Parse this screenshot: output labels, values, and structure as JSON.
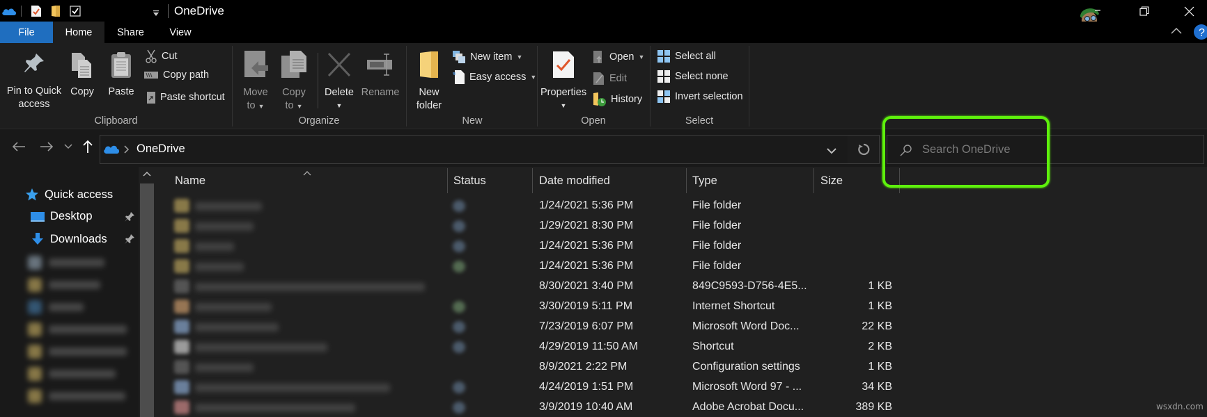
{
  "window": {
    "title": "OneDrive",
    "restore_label": "Restore",
    "close_label": "Close"
  },
  "quick_access_toolbar": {
    "icons": [
      "onedrive-icon",
      "properties-icon",
      "new-folder-icon",
      "checkbox-icon",
      "customize-dropdown-icon"
    ]
  },
  "ribbon_tabs": [
    {
      "label": "File",
      "active": false
    },
    {
      "label": "Home",
      "active": true
    },
    {
      "label": "Share",
      "active": false
    },
    {
      "label": "View",
      "active": false
    }
  ],
  "ribbon": {
    "clipboard": {
      "group_label": "Clipboard",
      "pin_line1": "Pin to Quick",
      "pin_line2": "access",
      "copy": "Copy",
      "paste": "Paste",
      "cut": "Cut",
      "copy_path": "Copy path",
      "paste_shortcut": "Paste shortcut"
    },
    "organize": {
      "group_label": "Organize",
      "move_line1": "Move",
      "move_line2": "to",
      "copy_line1": "Copy",
      "copy_line2": "to",
      "delete": "Delete",
      "rename": "Rename"
    },
    "new": {
      "group_label": "New",
      "new_folder_line1": "New",
      "new_folder_line2": "folder",
      "new_item": "New item",
      "easy_access": "Easy access"
    },
    "open": {
      "group_label": "Open",
      "properties": "Properties",
      "open": "Open",
      "edit": "Edit",
      "history": "History"
    },
    "select": {
      "group_label": "Select",
      "select_all": "Select all",
      "select_none": "Select none",
      "invert_selection": "Invert selection"
    }
  },
  "address_bar": {
    "path": "OneDrive",
    "search_placeholder": "Search OneDrive",
    "search_value": ""
  },
  "nav_pane": {
    "quick_access": "Quick access",
    "items": [
      {
        "label": "Desktop",
        "pinned": true
      },
      {
        "label": "Downloads",
        "pinned": true
      }
    ],
    "blurred_item_colors": [
      "#8a9aa8",
      "#b59f5a",
      "#3f6f98",
      "#b59f5a",
      "#b59f5a",
      "#b59f5a",
      "#b59f5a"
    ]
  },
  "file_list": {
    "columns": [
      "Name",
      "Status",
      "Date modified",
      "Type",
      "Size"
    ],
    "sort_column": "Name",
    "rows": [
      {
        "date": "1/24/2021 5:36 PM",
        "type": "File folder",
        "size": "",
        "icon_color": "#b59f5a",
        "status_color": "#6f8aa8"
      },
      {
        "date": "1/29/2021 8:30 PM",
        "type": "File folder",
        "size": "",
        "icon_color": "#b59f5a",
        "status_color": "#6f8aa8"
      },
      {
        "date": "1/24/2021 5:36 PM",
        "type": "File folder",
        "size": "",
        "icon_color": "#b59f5a",
        "status_color": "#6f8aa8"
      },
      {
        "date": "1/24/2021 5:36 PM",
        "type": "File folder",
        "size": "",
        "icon_color": "#b59f5a",
        "status_color": "#7ea87a"
      },
      {
        "date": "8/30/2021 3:40 PM",
        "type": "849C9593-D756-4E5...",
        "size": "1 KB",
        "icon_color": "#6a6a6a",
        "status_color": ""
      },
      {
        "date": "3/30/2019 5:11 PM",
        "type": "Internet Shortcut",
        "size": "1 KB",
        "icon_color": "#c99a6a",
        "status_color": "#7ea87a"
      },
      {
        "date": "7/23/2019 6:07 PM",
        "type": "Microsoft Word Doc...",
        "size": "22 KB",
        "icon_color": "#8aa8d0",
        "status_color": "#6f8aa8"
      },
      {
        "date": "4/29/2019 11:50 AM",
        "type": "Shortcut",
        "size": "2 KB",
        "icon_color": "#cfcfcf",
        "status_color": "#6f8aa8"
      },
      {
        "date": "8/9/2021 2:22 PM",
        "type": "Configuration settings",
        "size": "1 KB",
        "icon_color": "#6a6a6a",
        "status_color": ""
      },
      {
        "date": "4/24/2019 1:51 PM",
        "type": "Microsoft Word 97 - ...",
        "size": "34 KB",
        "icon_color": "#8aa8d0",
        "status_color": "#6f8aa8"
      },
      {
        "date": "3/9/2019 10:40 AM",
        "type": "Adobe Acrobat Docu...",
        "size": "389 KB",
        "icon_color": "#d08a8a",
        "status_color": "#6f8aa8"
      }
    ]
  },
  "annotation": {
    "highlight_color": "#5ef00c",
    "highlight_target": "search-box"
  },
  "watermark": "wsxdn.com",
  "colors": {
    "accent": "#1f6ebf",
    "onedrive_blue": "#2e8ee8",
    "folder_yellow": "#f2c45c"
  }
}
